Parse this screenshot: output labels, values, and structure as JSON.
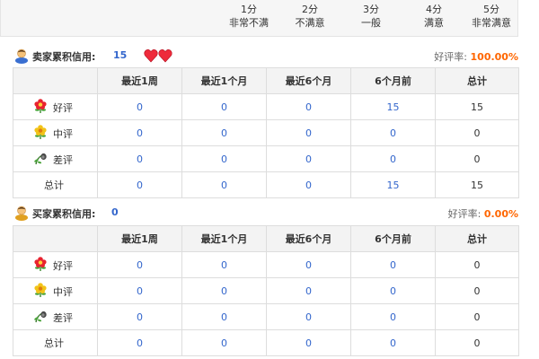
{
  "score_legend": [
    {
      "score": "1分",
      "desc": "非常不满"
    },
    {
      "score": "2分",
      "desc": "不满意"
    },
    {
      "score": "3分",
      "desc": "一般"
    },
    {
      "score": "4分",
      "desc": "满意"
    },
    {
      "score": "5分",
      "desc": "非常满意"
    }
  ],
  "seller": {
    "title": "卖家累积信用:",
    "score": "15",
    "rate_label": "好评率:",
    "rate_value": "100.00%",
    "columns": [
      "",
      "最近1周",
      "最近1个月",
      "最近6个月",
      "6个月前",
      "总计"
    ],
    "rows": [
      {
        "icon": "red-flower-icon",
        "label": "好评",
        "values": [
          "0",
          "0",
          "0",
          "15",
          "15"
        ]
      },
      {
        "icon": "yellow-flower-icon",
        "label": "中评",
        "values": [
          "0",
          "0",
          "0",
          "0",
          "0"
        ]
      },
      {
        "icon": "wilted-flower-icon",
        "label": "差评",
        "values": [
          "0",
          "0",
          "0",
          "0",
          "0"
        ]
      },
      {
        "icon": "",
        "label": "总计",
        "values": [
          "0",
          "0",
          "0",
          "15",
          "15"
        ]
      }
    ]
  },
  "buyer": {
    "title": "买家累积信用:",
    "score": "0",
    "rate_label": "好评率:",
    "rate_value": "0.00%",
    "columns": [
      "",
      "最近1周",
      "最近1个月",
      "最近6个月",
      "6个月前",
      "总计"
    ],
    "rows": [
      {
        "icon": "red-flower-icon",
        "label": "好评",
        "values": [
          "0",
          "0",
          "0",
          "0",
          "0"
        ]
      },
      {
        "icon": "yellow-flower-icon",
        "label": "中评",
        "values": [
          "0",
          "0",
          "0",
          "0",
          "0"
        ]
      },
      {
        "icon": "wilted-flower-icon",
        "label": "差评",
        "values": [
          "0",
          "0",
          "0",
          "0",
          "0"
        ]
      },
      {
        "icon": "",
        "label": "总计",
        "values": [
          "0",
          "0",
          "0",
          "0",
          "0"
        ]
      }
    ]
  },
  "colors": {
    "link_blue": "#3366cc",
    "rate_orange": "#ff6600",
    "header_bg": "#f3f3f3",
    "border": "#dddddd"
  }
}
